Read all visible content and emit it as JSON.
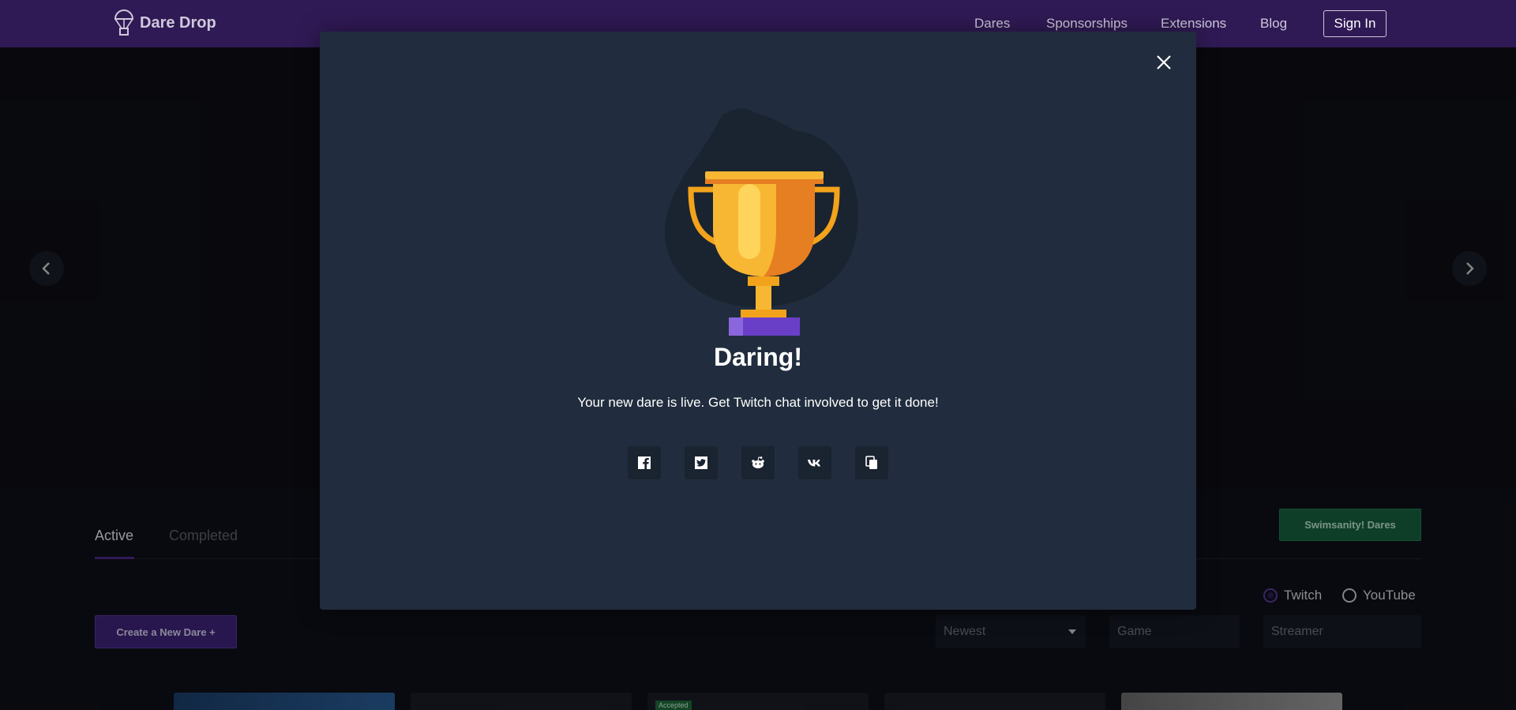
{
  "nav": {
    "brand": "Dare Drop",
    "links": [
      "Dares",
      "Sponsorships",
      "Extensions",
      "Blog"
    ],
    "sign_in": "Sign In"
  },
  "page": {
    "tabs": [
      "Active",
      "Completed"
    ],
    "sponsor_button": "Swimsanity! Dares",
    "create_button": "Create a New Dare +",
    "platforms": [
      "Twitch",
      "YouTube"
    ],
    "selected_platform": "Twitch",
    "sort_value": "Newest",
    "game_placeholder": "Game",
    "streamer_placeholder": "Streamer",
    "card_badge": "Accepted"
  },
  "modal": {
    "title": "Daring!",
    "message": "Your new dare is live. Get Twitch chat involved to get it done!",
    "share_icons": [
      "facebook-icon",
      "twitter-icon",
      "reddit-icon",
      "vk-icon",
      "copy-icon"
    ]
  },
  "colors": {
    "nav_bg": "#301a55",
    "modal_bg": "#212d3e",
    "accent_purple": "#3d2478",
    "accent_green": "#17603e",
    "trophy_gold": "#f5a623"
  }
}
